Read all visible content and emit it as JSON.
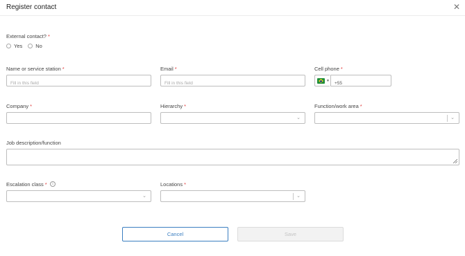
{
  "dialog": {
    "title": "Register contact",
    "close_icon": "close-icon"
  },
  "external_contact": {
    "label": "External contact?",
    "required_mark": "*",
    "options": [
      "Yes",
      "No"
    ]
  },
  "name_field": {
    "label": "Name or service station",
    "required_mark": "*",
    "placeholder": "Fill in this field"
  },
  "email_field": {
    "label": "Email",
    "required_mark": "*",
    "placeholder": "Fill in this field"
  },
  "cell_phone": {
    "label": "Cell phone",
    "required_mark": "*",
    "country_flag": "brazil-flag-icon",
    "value": "+55"
  },
  "company_field": {
    "label": "Company",
    "required_mark": "*"
  },
  "hierarchy_field": {
    "label": "Hierarchy",
    "required_mark": "*"
  },
  "function_field": {
    "label": "Function/work area",
    "required_mark": "*"
  },
  "job_description": {
    "label": "Job description/function"
  },
  "escalation_field": {
    "label": "Escalation class",
    "required_mark": "*",
    "info_icon": "info-icon"
  },
  "locations_field": {
    "label": "Locations",
    "required_mark": "*"
  },
  "buttons": {
    "cancel": "Cancel",
    "save": "Save"
  },
  "colors": {
    "required": "#e03c3c",
    "primary": "#3a7ec0",
    "disabled_bg": "#f2f2f2"
  }
}
